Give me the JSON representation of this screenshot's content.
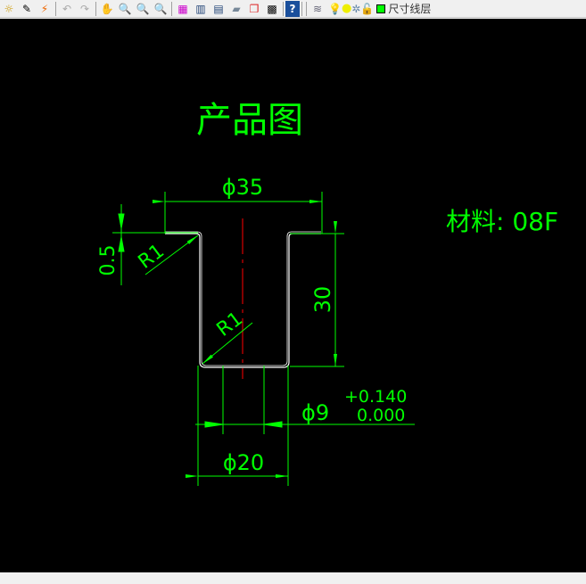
{
  "toolbar": {
    "icons": [
      "sun-icon",
      "pencil-icon",
      "lightning-icon",
      "undo-icon",
      "redo-icon",
      "pan-icon",
      "zoom-realtime-icon",
      "zoom-window-icon",
      "zoom-previous-icon",
      "properties-icon",
      "table-icon",
      "design-center-icon",
      "tool-palette-icon",
      "sheet-set-icon",
      "calculator-icon",
      "help-icon",
      "layers-icon",
      "bulb-icon",
      "sun-freeze-icon",
      "lock-viewport-icon",
      "lock-icon"
    ],
    "layer_color": "#00ff00",
    "layer_name": "尺寸线层"
  },
  "drawing": {
    "title": "产品图",
    "material": "材料: 08F",
    "dim_flange_dia": "ϕ35",
    "dim_thickness": "0.5",
    "dim_radius_top": "R1",
    "dim_radius_bottom": "R1",
    "dim_height": "30",
    "dim_hole_dia": "ϕ9",
    "tol_upper": "+0.140",
    "tol_lower": "0.000",
    "dim_outer_dia": "ϕ20",
    "colors": {
      "dim": "#00ff00",
      "outline": "#ffffff",
      "center": "#ff0000",
      "hatch": "#00ffff"
    }
  }
}
